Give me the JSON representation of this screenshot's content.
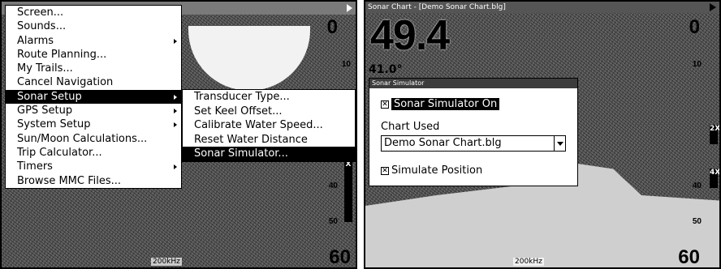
{
  "left": {
    "menu": {
      "items": [
        {
          "label": "Screen...",
          "arrow": false
        },
        {
          "label": "Sounds...",
          "arrow": false
        },
        {
          "label": "Alarms",
          "arrow": true
        },
        {
          "label": "Route Planning...",
          "arrow": false
        },
        {
          "label": "My Trails...",
          "arrow": false
        },
        {
          "label": "Cancel Navigation",
          "arrow": false
        },
        {
          "label": "Sonar Setup",
          "arrow": true,
          "selected": true
        },
        {
          "label": "GPS Setup",
          "arrow": true
        },
        {
          "label": "System Setup",
          "arrow": true
        },
        {
          "label": "Sun/Moon Calculations...",
          "arrow": false
        },
        {
          "label": "Trip Calculator...",
          "arrow": false
        },
        {
          "label": "Timers",
          "arrow": true
        },
        {
          "label": "Browse MMC Files...",
          "arrow": false
        }
      ]
    },
    "submenu": {
      "items": [
        {
          "label": "Transducer Type..."
        },
        {
          "label": "Set Keel Offset..."
        },
        {
          "label": "Calibrate Water Speed..."
        },
        {
          "label": "Reset Water Distance"
        },
        {
          "label": "Sonar Simulator...",
          "selected": true
        }
      ]
    },
    "depth_top": "0",
    "depth_10": "10",
    "depth_40": "40",
    "depth_50": "50",
    "depth_bottom": "60",
    "frequency": "200kHz",
    "zoom_label": "X"
  },
  "right": {
    "title": "Sonar Chart - [Demo Sonar Chart.blg]",
    "depth_reading": "49.4",
    "temp_reading": "41.0°",
    "depth_top": "0",
    "depth_10": "10",
    "depth_40": "40",
    "depth_50": "50",
    "depth_bottom": "60",
    "frequency": "200kHz",
    "zoom_2x": "2X",
    "zoom_4x": "4X",
    "dialog": {
      "title": "Sonar Simulator",
      "sim_on_label": "Sonar Simulator On",
      "chart_used_label": "Chart Used",
      "chart_selected": "Demo Sonar Chart.blg",
      "simulate_position_label": "Simulate Position"
    }
  },
  "colors": {
    "selection": "#000000",
    "titlebar": "#555555"
  }
}
